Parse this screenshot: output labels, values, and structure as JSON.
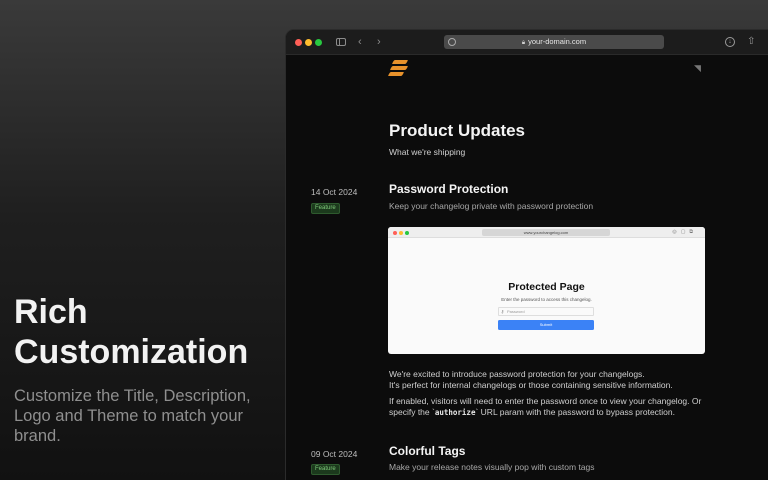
{
  "hero": {
    "title_line1": "Rich",
    "title_line2": "Customization",
    "description_line1": "Customize the Title, Description,",
    "description_line2": "Logo and Theme to match your",
    "description_line3": "brand."
  },
  "browser": {
    "url": "your-domain.com"
  },
  "page": {
    "title": "Product Updates",
    "subtitle": "What we're shipping"
  },
  "entries": [
    {
      "date": "14 Oct 2024",
      "badge": "Feature",
      "title": "Password Protection",
      "description": "Keep your changelog private with password protection",
      "body_line1": "We're excited to introduce password protection for your changelogs.",
      "body_line2": "It's perfect for internal changelogs or those containing sensitive information.",
      "body_line3": "If enabled, visitors will need to enter the password once to view your changelog. Or",
      "body_line4_pre": "specify the `",
      "body_line4_code": "authorize",
      "body_line4_post": "` URL param with the password to bypass protection."
    },
    {
      "date": "09 Oct 2024",
      "badge": "Feature",
      "title": "Colorful Tags",
      "description": "Make your release notes visually pop with custom tags"
    }
  ],
  "screenshot": {
    "url": "www.yourchangelog.com",
    "title": "Protected Page",
    "description": "Enter the password to access this changelog.",
    "placeholder": "Password",
    "button": "Submit"
  },
  "colors": {
    "accent": "#e8922b",
    "badge_text": "#7fc87a",
    "submit_button": "#3b82f6"
  }
}
